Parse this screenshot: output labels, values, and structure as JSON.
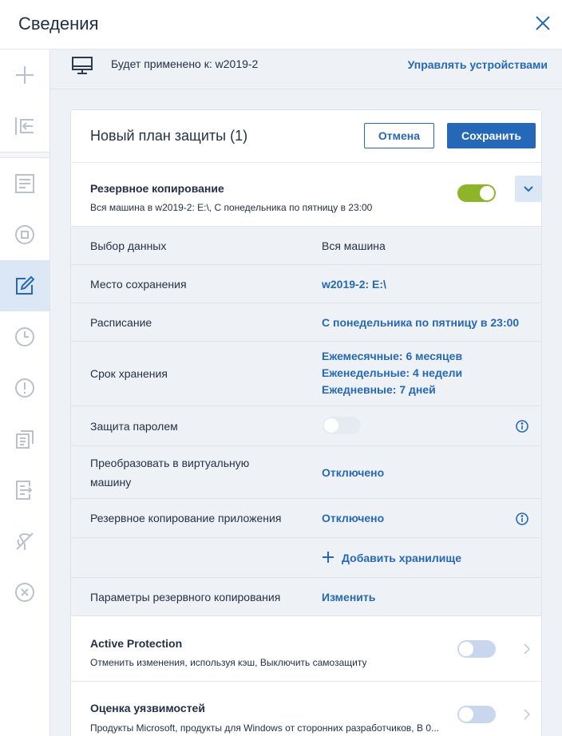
{
  "header": {
    "title": "Сведения"
  },
  "applied_bar": {
    "text": "Будет применено к: w2019-2",
    "manage_link": "Управлять устройствами"
  },
  "plan": {
    "title": "Новый план защиты (1)",
    "cancel_label": "Отмена",
    "save_label": "Сохранить"
  },
  "backup": {
    "title": "Резервное копирование",
    "description": "Вся машина в w2019-2: E:\\, С понедельника по пятницу в 23:00",
    "enabled": true,
    "rows": [
      {
        "label": "Выбор данных",
        "value": "Вся машина"
      },
      {
        "label": "Место сохранения",
        "value": "w2019-2: E:\\"
      },
      {
        "label": "Расписание",
        "value": "С понедельника по пятницу в 23:00"
      },
      {
        "label": "Срок хранения",
        "values": [
          "Ежемесячные: 6 месяцев",
          "Еженедельные: 4 недели",
          "Ежедневные: 7 дней"
        ]
      },
      {
        "label": "Защита паролем"
      },
      {
        "label_lines": [
          "Преобразовать в виртуальную",
          "машину"
        ],
        "value": "Отключено"
      },
      {
        "label": "Резервное копирование приложения",
        "value": "Отключено"
      },
      {
        "add_label": "Добавить хранилище"
      },
      {
        "label": "Параметры резервного копирования",
        "value": "Изменить"
      }
    ]
  },
  "active_protection": {
    "title": "Active Protection",
    "description": "Отменить изменения, используя кэш, Выключить самозащиту",
    "enabled": false
  },
  "vulnerability": {
    "title": "Оценка уязвимостей",
    "description": "Продукты Microsoft, продукты для Windows от сторонних разработчиков, В 0...",
    "enabled": false
  },
  "icons": {
    "close": "close-icon",
    "monitor": "monitor-icon",
    "expand": "chevron-down-icon",
    "info": "info-icon",
    "add": "plus-icon",
    "chevron": "chevron-right-icon"
  },
  "colors": {
    "accent": "#2668b8",
    "toggle_on": "#8cb52a",
    "toggle_off": "#c9d7ee",
    "row_bg": "#eef2f6"
  }
}
